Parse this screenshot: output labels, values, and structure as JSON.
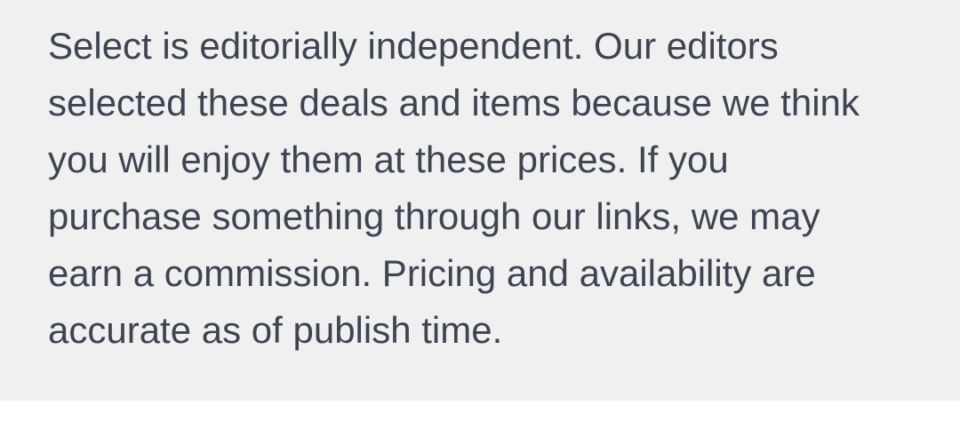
{
  "disclaimer": {
    "lines": [
      "Select is editorially independent. Our editors",
      "selected these deals and items because we think",
      "you will enjoy them at these prices. If you",
      "purchase something through our links, we may",
      "earn a commission. Pricing and availability are",
      "accurate as of publish time."
    ]
  },
  "colors": {
    "box_background": "#f0f0f0",
    "text": "#3d4452",
    "page_background": "#ffffff"
  }
}
